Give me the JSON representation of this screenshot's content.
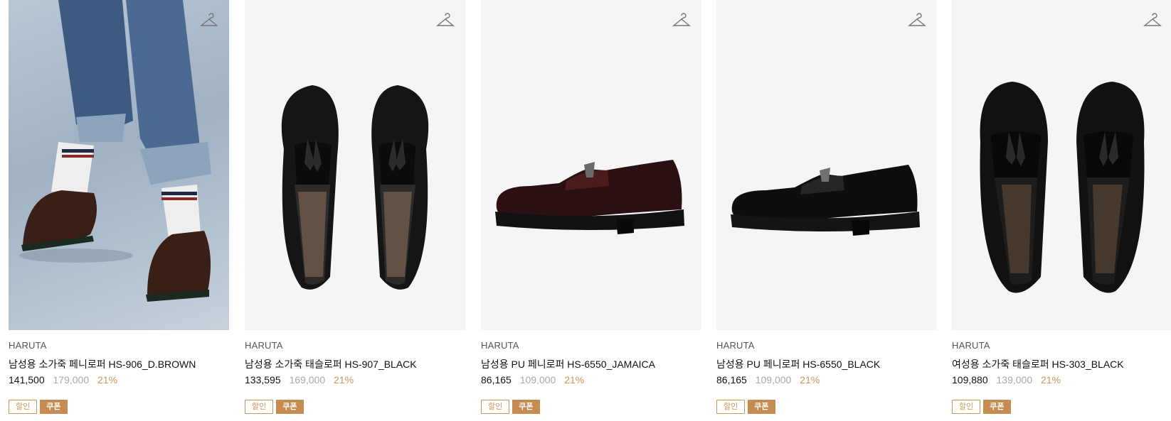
{
  "colors": {
    "accent": "#c8975a",
    "coupon_bg": "#c58b50",
    "original_price": "#a9a9a9",
    "thumb_bg": "#f5f5f5"
  },
  "products": [
    {
      "brand": "HARUTA",
      "name": "남성용 소가죽 페니로퍼 HS-906_D.BROWN",
      "price": "141,500",
      "original_price": "179,000",
      "discount": "21%",
      "badge_sale": "할인",
      "badge_coupon": "쿠폰",
      "image": "model-wearing-brown-penny-loafers",
      "wishlist_icon": "hanger-icon"
    },
    {
      "brand": "HARUTA",
      "name": "남성용 소가죽 태슬로퍼 HS-907_BLACK",
      "price": "133,595",
      "original_price": "169,000",
      "discount": "21%",
      "badge_sale": "할인",
      "badge_coupon": "쿠폰",
      "image": "black-tassel-loafers-top-view",
      "wishlist_icon": "hanger-icon"
    },
    {
      "brand": "HARUTA",
      "name": "남성용 PU 페니로퍼 HS-6550_JAMAICA",
      "price": "86,165",
      "original_price": "109,000",
      "discount": "21%",
      "badge_sale": "할인",
      "badge_coupon": "쿠폰",
      "image": "dark-red-penny-loafer-side-view",
      "wishlist_icon": "hanger-icon"
    },
    {
      "brand": "HARUTA",
      "name": "남성용 PU 페니로퍼 HS-6550_BLACK",
      "price": "86,165",
      "original_price": "109,000",
      "discount": "21%",
      "badge_sale": "할인",
      "badge_coupon": "쿠폰",
      "image": "black-penny-loafer-side-view",
      "wishlist_icon": "hanger-icon"
    },
    {
      "brand": "HARUTA",
      "name": "여성용 소가죽 태슬로퍼 HS-303_BLACK",
      "price": "109,880",
      "original_price": "139,000",
      "discount": "21%",
      "badge_sale": "할인",
      "badge_coupon": "쿠폰",
      "image": "womens-black-tassel-loafers-top-view",
      "wishlist_icon": "hanger-icon"
    }
  ]
}
